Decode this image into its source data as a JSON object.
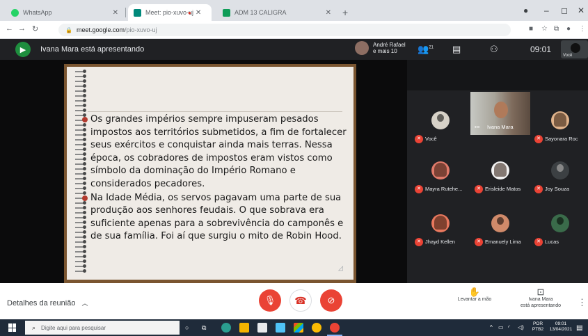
{
  "browser": {
    "tabs": [
      {
        "title": "WhatsApp",
        "icon": "whatsapp-icon",
        "color": "#25d366",
        "active": false
      },
      {
        "title": "Meet: pio-xuvo-uj",
        "icon": "meet-icon",
        "color": "#00897b",
        "active": true
      },
      {
        "title": "ADM 13 CALIGRA",
        "icon": "classroom-icon",
        "color": "#0f9d58",
        "active": false
      }
    ],
    "new_tab": "+",
    "url_host": "meet.google.com",
    "url_path": "/pio-xuvo-uj"
  },
  "meet": {
    "presenter_text": "Ivana Mara está apresentando",
    "pinned_name": "André Rafael",
    "pinned_more": "e mais 10",
    "participant_count": "21",
    "time": "09:01",
    "self_label": "Você",
    "slide": {
      "paragraphs": [
        "Os grandes impérios sempre impuseram pesados impostos aos territórios submetidos, a fim de fortalecer seus exércitos e conquistar ainda mais terras. Nessa época, os cobradores de impostos eram vistos como símbolo da dominação do Império Romano e considerados pecadores.",
        "Na Idade Média, os servos pagavam uma parte de sua produção aos senhores feudais. O que sobrava era suficiente apenas para a sobrevivência do camponês e de sua família. Foi aí que surgiu o mito de Robin Hood."
      ]
    },
    "participants": [
      {
        "name": "Você",
        "color": "#d7d2c8"
      },
      {
        "name": "Ivana Mara",
        "color": "#6d6a65"
      },
      {
        "name": "Sayonara Roc",
        "color": "#e0b38b"
      },
      {
        "name": "Mayra Rutehe...",
        "color": "#e07a6a"
      },
      {
        "name": "Erisleide Matos",
        "color": "#f1f1f1"
      },
      {
        "name": "Joy Souza",
        "color": "#3c4043"
      },
      {
        "name": "Jhayd Kellen",
        "color": "#e8785e"
      },
      {
        "name": "Emanuely Lima",
        "color": "#d08a6a"
      },
      {
        "name": "Lucas",
        "color": "#3a6b4a"
      }
    ],
    "bottom": {
      "details": "Detalhes da reunião",
      "raise_hand": "Levantar a mão",
      "presenting_line1": "Ivana Mara",
      "presenting_line2": "está apresentando"
    }
  },
  "taskbar": {
    "search_placeholder": "Digite aqui para pesquisar",
    "lang": "POR PTB2",
    "clock_time": "09:01",
    "clock_date": "13/04/2021"
  }
}
